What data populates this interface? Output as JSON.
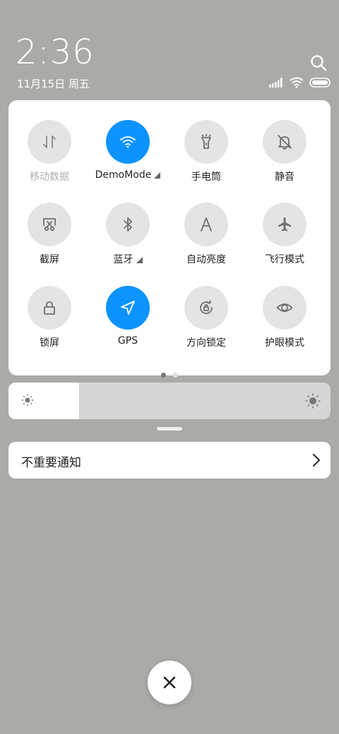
{
  "status": {
    "time": "2:36",
    "date": "11月15日 周五",
    "icons": [
      "signal-icon",
      "wifi-icon",
      "battery-icon"
    ]
  },
  "tiles": [
    {
      "label": "移动数据",
      "icon": "mobile-data-icon",
      "active": false,
      "disabled": true
    },
    {
      "label": "DemoMode",
      "icon": "wifi-icon",
      "active": true,
      "expandable": true
    },
    {
      "label": "手电筒",
      "icon": "flashlight-icon",
      "active": false
    },
    {
      "label": "静音",
      "icon": "mute-bell-icon",
      "active": false
    },
    {
      "label": "截屏",
      "icon": "screenshot-icon",
      "active": false
    },
    {
      "label": "蓝牙",
      "icon": "bluetooth-icon",
      "active": false,
      "expandable": true
    },
    {
      "label": "自动亮度",
      "icon": "auto-brightness-icon",
      "active": false
    },
    {
      "label": "飞行模式",
      "icon": "airplane-icon",
      "active": false
    },
    {
      "label": "锁屏",
      "icon": "lock-icon",
      "active": false
    },
    {
      "label": "GPS",
      "icon": "location-arrow-icon",
      "active": true
    },
    {
      "label": "方向锁定",
      "icon": "rotation-lock-icon",
      "active": false
    },
    {
      "label": "护眼模式",
      "icon": "eye-icon",
      "active": false
    }
  ],
  "pager": {
    "pages": 2,
    "current": 1
  },
  "brightness": {
    "level": 0.22
  },
  "notification": {
    "label": "不重要通知"
  },
  "colors": {
    "accent": "#0d93ff",
    "tile_bg": "#e4e4e4",
    "backdrop": "#a9aba7"
  }
}
